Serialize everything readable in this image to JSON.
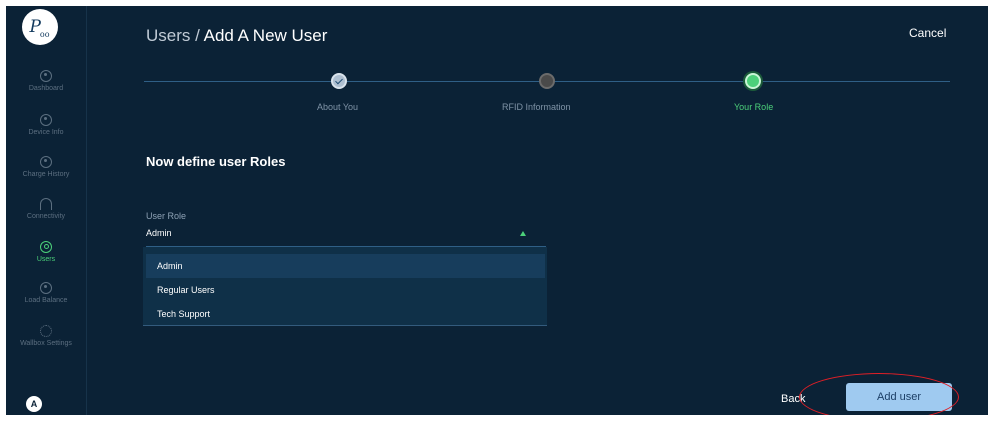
{
  "logo": {
    "text": "P",
    "sub": "oo"
  },
  "sidebar": {
    "items": [
      {
        "label": "Dashboard",
        "icon": "dashboard-icon"
      },
      {
        "label": "Device Info",
        "icon": "info-icon"
      },
      {
        "label": "Charge History",
        "icon": "history-icon"
      },
      {
        "label": "Connectivity",
        "icon": "connectivity-icon"
      },
      {
        "label": "Users",
        "icon": "users-icon",
        "active": true
      },
      {
        "label": "Load Balance",
        "icon": "load-balance-icon"
      },
      {
        "label": "Wallbox Settings",
        "icon": "settings-icon"
      }
    ],
    "bottom_avatar": "A"
  },
  "header": {
    "breadcrumb_parent": "Users",
    "separator": " / ",
    "breadcrumb_current": "Add A New User",
    "cancel": "Cancel"
  },
  "stepper": {
    "steps": [
      {
        "label": "About You",
        "status": "done"
      },
      {
        "label": "RFID Information",
        "status": "pending"
      },
      {
        "label": "Your Role",
        "status": "active"
      }
    ]
  },
  "form": {
    "heading": "Now define user Roles",
    "role_label": "User Role",
    "role_value": "Admin",
    "options": [
      "Admin",
      "Regular Users",
      "Tech Support"
    ]
  },
  "footer": {
    "back": "Back",
    "submit": "Add user"
  },
  "colors": {
    "background": "#0b2236",
    "accent": "#4cd07a",
    "primary_button": "#9fcaf0",
    "highlight_ellipse": "#e01f26"
  }
}
